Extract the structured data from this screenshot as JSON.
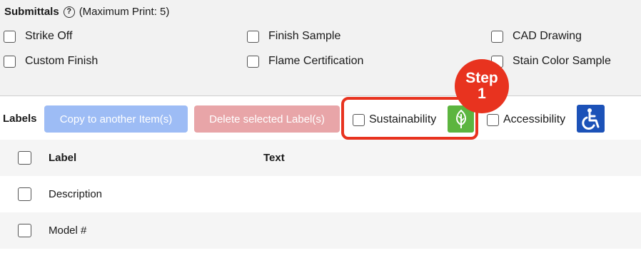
{
  "submittals": {
    "title": "Submittals",
    "note": "(Maximum Print: 5)",
    "help_glyph": "?",
    "options": [
      {
        "label": "Strike Off",
        "checked": false
      },
      {
        "label": "Finish Sample",
        "checked": false
      },
      {
        "label": "CAD Drawing",
        "checked": false
      },
      {
        "label": "Custom Finish",
        "checked": false
      },
      {
        "label": "Flame Certification",
        "checked": false
      },
      {
        "label": "Stain Color Sample",
        "checked": false
      }
    ]
  },
  "labels_bar": {
    "title": "Labels",
    "copy_button": "Copy to another Item(s)",
    "delete_button": "Delete selected Label(s)",
    "sustainability": {
      "label": "Sustainability",
      "checked": false,
      "icon": "leaf-icon",
      "icon_color": "#5cb53f"
    },
    "accessibility": {
      "label": "Accessibility",
      "checked": false,
      "icon": "wheelchair-icon",
      "icon_color": "#1c52b8"
    }
  },
  "step_callout": {
    "line1": "Step",
    "line2": "1",
    "color": "#e8331f"
  },
  "table": {
    "headers": {
      "label": "Label",
      "text": "Text"
    },
    "rows": [
      {
        "label": "Description",
        "text": ""
      },
      {
        "label": "Model #",
        "text": ""
      }
    ]
  }
}
